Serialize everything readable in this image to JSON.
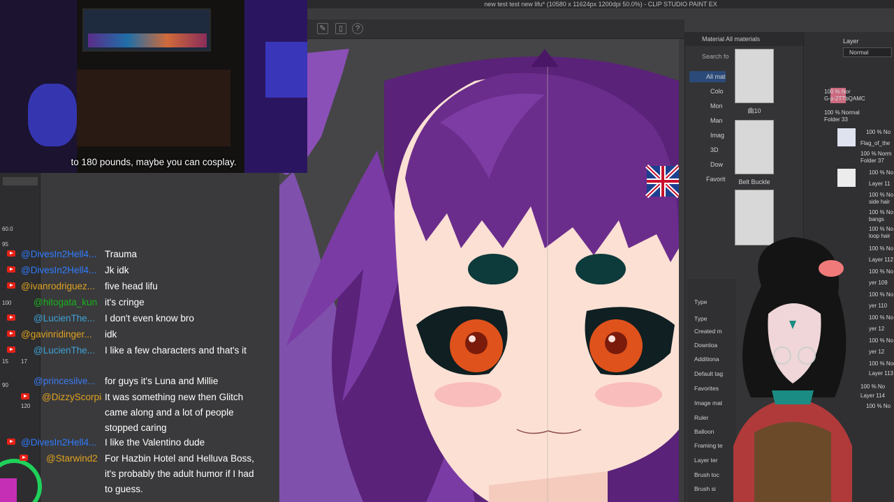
{
  "app": {
    "title": "new test test new lifu* (10580 x 11624px 1200dpi 50.0%) - CLIP STUDIO PAINT EX"
  },
  "video": {
    "caption": "to 180 pounds, maybe you can cosplay."
  },
  "chat": {
    "left_numbers": [
      "60.0",
      "95",
      "100",
      "15",
      "17",
      "90",
      "120"
    ],
    "messages": [
      {
        "user": "@DivesIn2Hell4...",
        "text": "Trauma",
        "color": "#2f7cff"
      },
      {
        "user": "@DivesIn2Hell4...",
        "text": "Jk idk",
        "color": "#2f7cff"
      },
      {
        "user": "@ivanrodriguez...",
        "text": "five head lifu",
        "color": "#e0a21f"
      },
      {
        "user": "@hitogata_kun",
        "text": "it's cringe",
        "color": "#19b21e"
      },
      {
        "user": "@LucienThe...",
        "text": "I don't even know bro",
        "color": "#3fa3d8"
      },
      {
        "user": "@gavinridinger...",
        "text": "idk",
        "color": "#e0a21f"
      },
      {
        "user": "@LucienThe...",
        "text": "I like a few characters and that's it",
        "color": "#3fa3d8"
      },
      {
        "user": "@princesilve...",
        "text": "for guys it's Luna and Millie",
        "color": "#3b7bf0"
      },
      {
        "user": "@DizzyScorpia",
        "text": "It was something new then Glitch came along and a lot of people stopped caring",
        "color": "#e0a21f"
      },
      {
        "user": "@DivesIn2Hell4...",
        "text": "I like the Valentino dude",
        "color": "#2f7cff"
      },
      {
        "user": "@Starwind2",
        "text": "For Hazbin Hotel and Helluva Boss, it's probably the adult humor if I had to guess.",
        "color": "#e0a21f"
      }
    ]
  },
  "materials": {
    "header": "Material  All materials",
    "search_placeholder": "Search fo",
    "tree": [
      "All mat",
      "Colo",
      "Mon",
      "Man",
      "Imag",
      "3D",
      "Dow",
      "Favorit"
    ],
    "thumbs": [
      {
        "label": "曲10"
      },
      {
        "label": "Belt Buckle"
      }
    ],
    "settings": [
      "Type",
      "Type",
      "Created m",
      "Downloa",
      "Additiona",
      "Default tag",
      "Favorites",
      "Image mat",
      "Ruler",
      "Balloon",
      "Framing te",
      "Layer ter",
      "Brush toc",
      "Brush si"
    ]
  },
  "layers": {
    "title": "Layer",
    "blend_mode": "Normal",
    "rows": [
      "100 % Nor",
      "G-p-2TTbQAMC",
      "100 % Normal",
      "Folder 33",
      "100 % No",
      "Flag_of_the",
      "100 % Norm",
      "Folder 37",
      "100 % No",
      "Layer 11",
      "100 % No",
      "side hair",
      "100 % No",
      "bangs",
      "100 % No",
      "loop hair",
      "100 % No",
      "Layer 112",
      "100 % No",
      "yer 109",
      "100 % No",
      "yer 110",
      "100 % No",
      "yer 12",
      "100 % No",
      "yer 12",
      "100 % Norm",
      "Layer 113",
      "100 % No",
      "Layer 114",
      "100 % No"
    ]
  },
  "colors": {
    "hair": "#6b2d8c",
    "hair_dark": "#4a1766",
    "skin": "#fce0d4",
    "bg_purple": "#8b50b8",
    "canvas_bg": "#454547",
    "eye": "#e0521c",
    "accent_teal": "#1a8c83"
  }
}
